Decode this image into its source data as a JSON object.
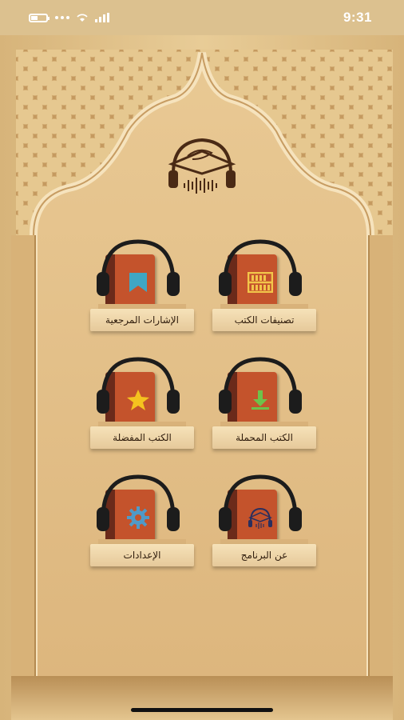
{
  "status_bar": {
    "time": "9:31",
    "icons": [
      "battery-icon",
      "dots-icon",
      "wifi-icon",
      "signal-icon"
    ]
  },
  "app": {
    "logo_icon": "headphones-book-logo"
  },
  "grid": {
    "items": [
      {
        "label": "الإشارات المرجعية",
        "icon": "bookmark-icon",
        "color": "#3fa6c4"
      },
      {
        "label": "تصنيفات الكتب",
        "icon": "shelf-icon",
        "color": "#f2c64a"
      },
      {
        "label": "الكتب المفضلة",
        "icon": "star-icon",
        "color": "#f5c21f"
      },
      {
        "label": "الكتب المحملة",
        "icon": "download-icon",
        "color": "#6dc24b"
      },
      {
        "label": "الإعدادات",
        "icon": "gear-icon",
        "color": "#4f9ac8"
      },
      {
        "label": "عن البرنامج",
        "icon": "logo-icon",
        "color": "#2a2f5e"
      }
    ]
  }
}
